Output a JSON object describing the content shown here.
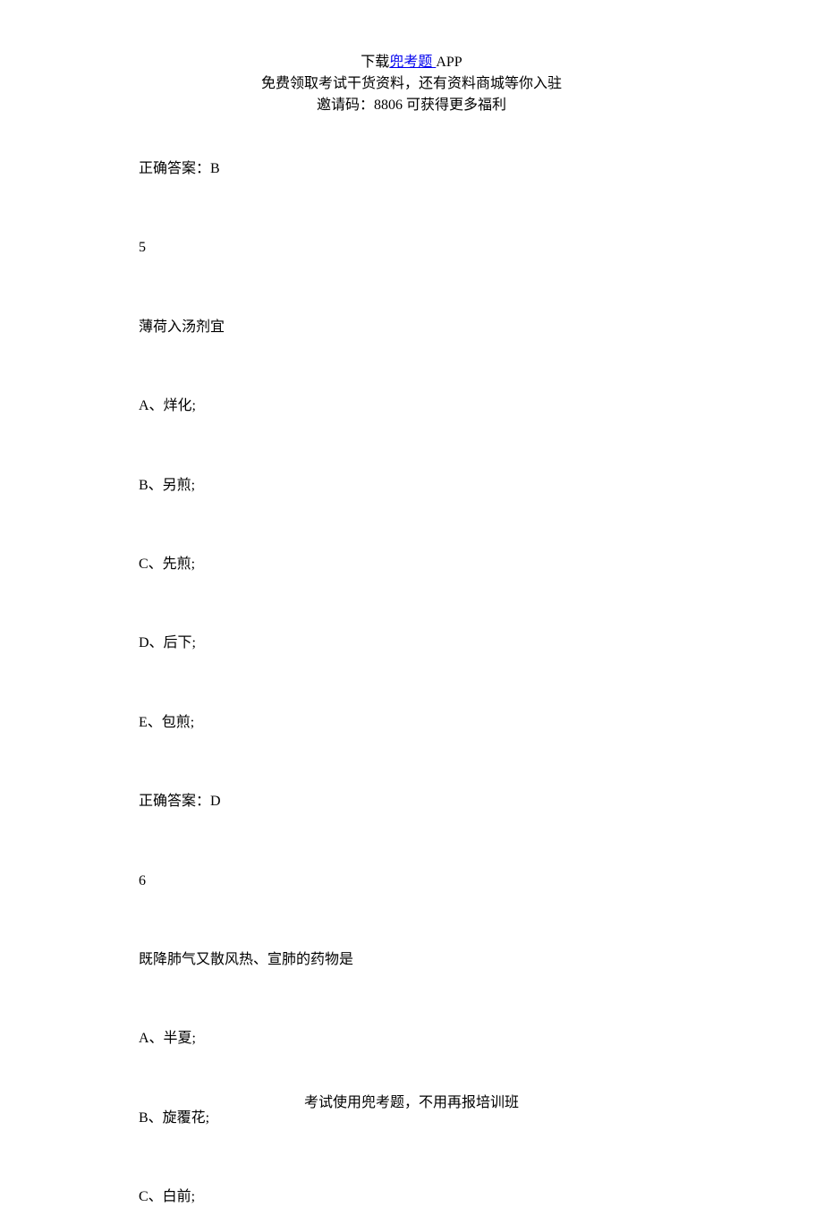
{
  "header": {
    "download_prefix": "下载",
    "link_text": "兜考题 ",
    "download_suffix": "APP",
    "line2": "免费领取考试干货资料，还有资料商城等你入驻",
    "line3": "邀请码：8806  可获得更多福利"
  },
  "content": {
    "answer_prev": "正确答案：B",
    "q5_number": "5",
    "q5_text": "薄荷入汤剂宜",
    "q5_option_a": "A、烊化;",
    "q5_option_b": "B、另煎;",
    "q5_option_c": "C、先煎;",
    "q5_option_d": "D、后下;",
    "q5_option_e": "E、包煎;",
    "q5_answer": "正确答案：D",
    "q6_number": "6",
    "q6_text": "既降肺气又散风热、宣肺的药物是",
    "q6_option_a": "A、半夏;",
    "q6_option_b": "B、旋覆花;",
    "q6_option_c": "C、白前;"
  },
  "footer": {
    "text": "考试使用兜考题，不用再报培训班"
  }
}
